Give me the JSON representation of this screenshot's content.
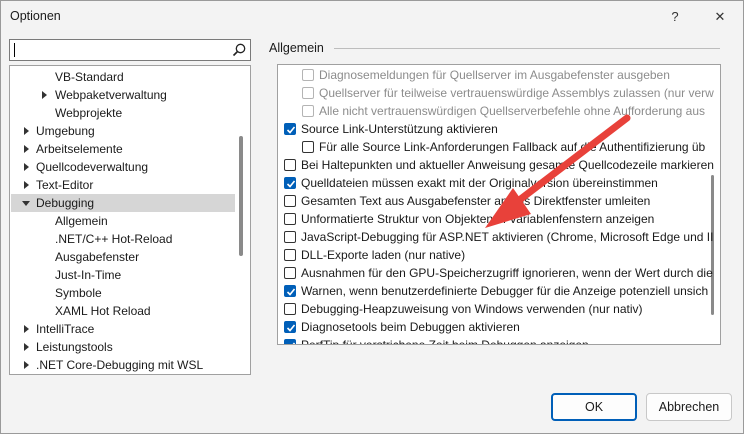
{
  "window": {
    "title": "Optionen",
    "help_label": "?",
    "close_label": "✕"
  },
  "search": {
    "value": ""
  },
  "tree": {
    "items": [
      {
        "label": "VB-Standard",
        "indent": 2,
        "expandable": false,
        "selected": false
      },
      {
        "label": "Webpaketverwaltung",
        "indent": 2,
        "expandable": true,
        "selected": false
      },
      {
        "label": "Webprojekte",
        "indent": 2,
        "expandable": false,
        "selected": false
      },
      {
        "label": "Umgebung",
        "indent": 0,
        "expandable": true,
        "selected": false
      },
      {
        "label": "Arbeitselemente",
        "indent": 0,
        "expandable": true,
        "selected": false
      },
      {
        "label": "Quellcodeverwaltung",
        "indent": 0,
        "expandable": true,
        "selected": false
      },
      {
        "label": "Text-Editor",
        "indent": 0,
        "expandable": true,
        "selected": false
      },
      {
        "label": "Debugging",
        "indent": 0,
        "expandable": true,
        "expanded": true,
        "selected": true
      },
      {
        "label": "Allgemein",
        "indent": 2,
        "expandable": false,
        "selected": false
      },
      {
        "label": ".NET/C++ Hot-Reload",
        "indent": 2,
        "expandable": false,
        "selected": false
      },
      {
        "label": "Ausgabefenster",
        "indent": 2,
        "expandable": false,
        "selected": false
      },
      {
        "label": "Just-In-Time",
        "indent": 2,
        "expandable": false,
        "selected": false
      },
      {
        "label": "Symbole",
        "indent": 2,
        "expandable": false,
        "selected": false
      },
      {
        "label": "XAML Hot Reload",
        "indent": 2,
        "expandable": false,
        "selected": false
      },
      {
        "label": "IntelliTrace",
        "indent": 0,
        "expandable": true,
        "selected": false
      },
      {
        "label": "Leistungstools",
        "indent": 0,
        "expandable": true,
        "selected": false
      },
      {
        ".label": "",
        "label": ".NET Core-Debugging mit WSL",
        "indent": 0,
        "expandable": true,
        "selected": false
      }
    ]
  },
  "panel": {
    "title": "Allgemein",
    "options": [
      {
        "label": "Diagnosemeldungen für Quellserver im Ausgabefenster ausgeben",
        "indent": 1,
        "checked": false,
        "disabled": true
      },
      {
        "label": "Quellserver für teilweise vertrauenswürdige Assemblys zulassen (nur verw",
        "indent": 1,
        "checked": false,
        "disabled": true
      },
      {
        "label": "Alle nicht vertrauenswürdigen Quellserverbefehle ohne Aufforderung aus",
        "indent": 1,
        "checked": false,
        "disabled": true
      },
      {
        "label": "Source Link-Unterstützung aktivieren",
        "indent": 0,
        "checked": true,
        "disabled": false
      },
      {
        "label": "Für alle Source Link-Anforderungen Fallback auf die Authentifizierung üb",
        "indent": 1,
        "checked": false,
        "disabled": false
      },
      {
        "label": "Bei Haltepunkten und aktueller Anweisung gesamte Quellcodezeile markieren",
        "indent": 0,
        "checked": false,
        "disabled": false
      },
      {
        "label": "Quelldateien müssen exakt mit der Originalversion übereinstimmen",
        "indent": 0,
        "checked": true,
        "disabled": false
      },
      {
        "label": "Gesamten Text aus Ausgabefenster an das Direktfenster umleiten",
        "indent": 0,
        "checked": false,
        "disabled": false
      },
      {
        "label": "Unformatierte Struktur von Objekten in Variablenfenstern anzeigen",
        "indent": 0,
        "checked": false,
        "disabled": false
      },
      {
        "label": "JavaScript-Debugging für ASP.NET aktivieren (Chrome, Microsoft Edge und II",
        "indent": 0,
        "checked": false,
        "disabled": false
      },
      {
        "label": "DLL-Exporte laden (nur native)",
        "indent": 0,
        "checked": false,
        "disabled": false
      },
      {
        "label": "Ausnahmen für den GPU-Speicherzugriff ignorieren, wenn der Wert durch die",
        "indent": 0,
        "checked": false,
        "disabled": false
      },
      {
        "label": "Warnen, wenn benutzerdefinierte Debugger für die Anzeige potenziell unsich",
        "indent": 0,
        "checked": true,
        "disabled": false
      },
      {
        "label": "Debugging-Heapzuweisung von Windows verwenden (nur nativ)",
        "indent": 0,
        "checked": false,
        "disabled": false
      },
      {
        "label": "Diagnosetools beim Debuggen aktivieren",
        "indent": 0,
        "checked": true,
        "disabled": false
      },
      {
        "label": "PerfTip für verstrichene Zeit beim Debuggen anzeigen",
        "indent": 0,
        "checked": true,
        "disabled": false
      }
    ]
  },
  "buttons": {
    "ok_label": "OK",
    "cancel_label": "Abbrechen"
  },
  "colors": {
    "accent": "#005fb8",
    "arrow": "#e8413a",
    "selection": "#d6d6d6"
  }
}
